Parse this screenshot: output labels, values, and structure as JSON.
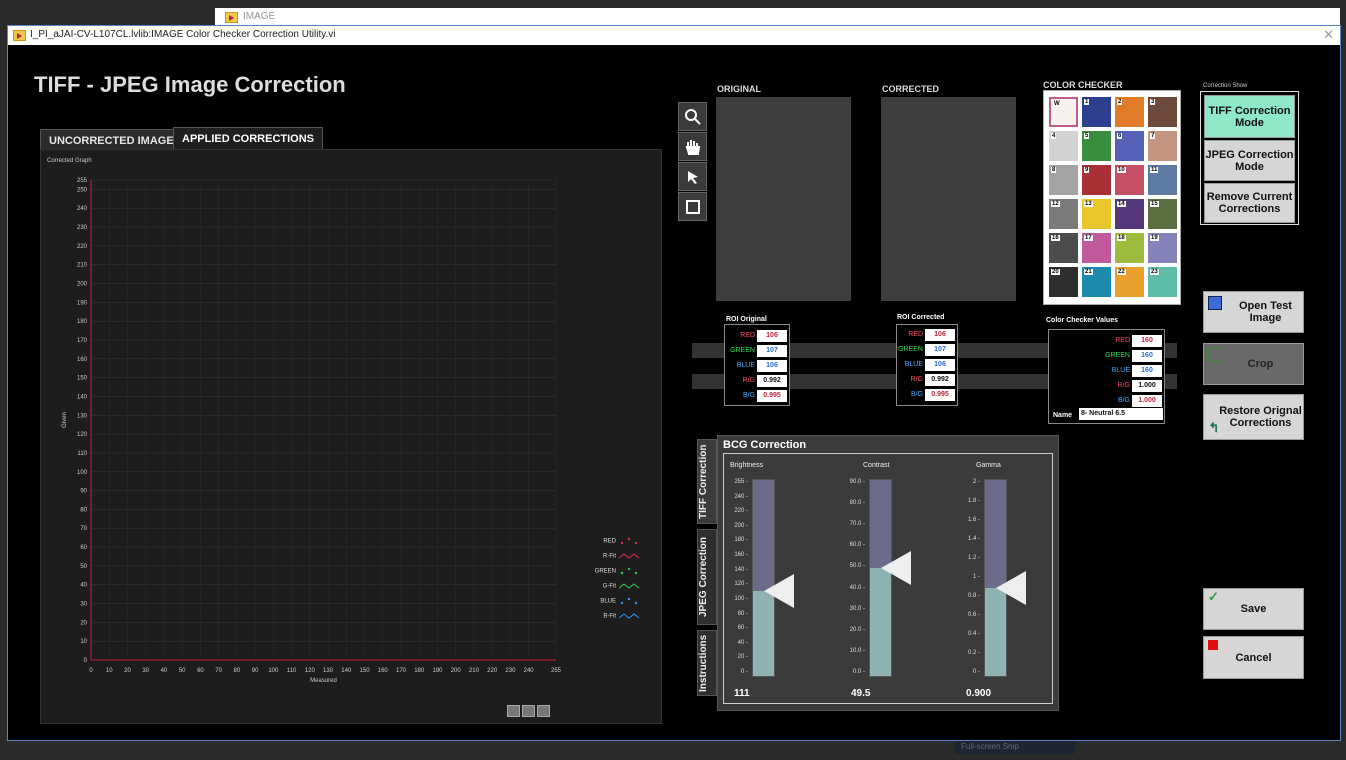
{
  "background": {
    "window_title": "IMAGE",
    "overlay_label": "Full-screen Snip"
  },
  "window": {
    "title": "I_PI_aJAI-CV-L107CL.lvlib:IMAGE Color Checker Correction Utility.vi",
    "close": "✕"
  },
  "app_title": "TIFF - JPEG Image Correction",
  "tabs": [
    "UNCORRECTED IMAGE",
    "APPLIED CORRECTIONS"
  ],
  "graph": {
    "title": "Corrected Graph",
    "xlabel": "Measured",
    "ylabel": "Given",
    "x_ticks": [
      "0",
      "10",
      "20",
      "30",
      "40",
      "50",
      "60",
      "70",
      "80",
      "90",
      "100",
      "110",
      "120",
      "130",
      "140",
      "150",
      "160",
      "170",
      "180",
      "190",
      "200",
      "210",
      "220",
      "230",
      "240",
      "255"
    ],
    "y_ticks": [
      "0",
      "10",
      "20",
      "30",
      "40",
      "50",
      "60",
      "70",
      "80",
      "90",
      "100",
      "110",
      "120",
      "130",
      "140",
      "150",
      "160",
      "170",
      "180",
      "190",
      "200",
      "210",
      "220",
      "230",
      "240",
      "250",
      "255"
    ],
    "legend": [
      {
        "label": "RED",
        "kind": "points",
        "color": "#e0304a"
      },
      {
        "label": "R-Fit",
        "kind": "line",
        "color": "#e0304a"
      },
      {
        "label": "GREEN",
        "kind": "points",
        "color": "#33cc55"
      },
      {
        "label": "G-Fit",
        "kind": "line",
        "color": "#33cc55"
      },
      {
        "label": "BLUE",
        "kind": "points",
        "color": "#3399ff"
      },
      {
        "label": "B-Fit",
        "kind": "line",
        "color": "#3399ff"
      }
    ]
  },
  "tools": [
    "zoom-icon",
    "pan-hand-icon",
    "pointer-arrow-icon",
    "roi-rectangle-icon"
  ],
  "panels": {
    "original": "ORIGINAL",
    "corrected": "CORRECTED",
    "color_checker": "COLOR CHECKER",
    "correction_show": "Correction Show"
  },
  "swatches": [
    {
      "label": "W",
      "color": "#f4f1ee"
    },
    {
      "label": "1",
      "color": "#2c3f8e"
    },
    {
      "label": "2",
      "color": "#e07b2a"
    },
    {
      "label": "3",
      "color": "#6e4a3c"
    },
    {
      "label": "4",
      "color": "#d3d3d3"
    },
    {
      "label": "5",
      "color": "#3a8d3f"
    },
    {
      "label": "6",
      "color": "#5560b7"
    },
    {
      "label": "7",
      "color": "#c49580"
    },
    {
      "label": "8",
      "color": "#a3a3a3"
    },
    {
      "label": "9",
      "color": "#a93037"
    },
    {
      "label": "10",
      "color": "#c44e63"
    },
    {
      "label": "11",
      "color": "#5e7aa3"
    },
    {
      "label": "12",
      "color": "#7a7a7a"
    },
    {
      "label": "13",
      "color": "#e8c62c"
    },
    {
      "label": "14",
      "color": "#54367a"
    },
    {
      "label": "15",
      "color": "#5c6d3f"
    },
    {
      "label": "16",
      "color": "#4c4c4c"
    },
    {
      "label": "17",
      "color": "#c05a9c"
    },
    {
      "label": "18",
      "color": "#9dbc3d"
    },
    {
      "label": "19",
      "color": "#8583ba"
    },
    {
      "label": "20",
      "color": "#2e2e2e"
    },
    {
      "label": "21",
      "color": "#1c8aac"
    },
    {
      "label": "22",
      "color": "#e9a02c"
    },
    {
      "label": "23",
      "color": "#5fbca8"
    }
  ],
  "roi_original": {
    "title": "ROI Original",
    "rows": [
      {
        "key": "RED",
        "value": "106",
        "kcolor": "#ff4a5e",
        "vcolor": "#c0243a"
      },
      {
        "key": "GREEN",
        "value": "107",
        "kcolor": "#33dd55",
        "vcolor": "#2a6bd0"
      },
      {
        "key": "BLUE",
        "value": "106",
        "kcolor": "#4aa8ff",
        "vcolor": "#2a6bd0"
      },
      {
        "key": "R/G",
        "value": "0.992",
        "kcolor": "#ff4a5e",
        "vcolor": "#111111"
      },
      {
        "key": "B/G",
        "value": "0.995",
        "kcolor": "#4aa8ff",
        "vcolor": "#c0243a"
      }
    ]
  },
  "roi_corrected": {
    "title": "ROI Corrected",
    "rows": [
      {
        "key": "RED",
        "value": "106",
        "kcolor": "#ff4a5e",
        "vcolor": "#c0243a"
      },
      {
        "key": "GREEN",
        "value": "107",
        "kcolor": "#33dd55",
        "vcolor": "#2a6bd0"
      },
      {
        "key": "BLUE",
        "value": "106",
        "kcolor": "#4aa8ff",
        "vcolor": "#2a6bd0"
      },
      {
        "key": "R/G",
        "value": "0.992",
        "kcolor": "#ff4a5e",
        "vcolor": "#111111"
      },
      {
        "key": "B/G",
        "value": "0.995",
        "kcolor": "#4aa8ff",
        "vcolor": "#c0243a"
      }
    ]
  },
  "checker_values": {
    "title": "Color Checker Values",
    "rows": [
      {
        "key": "RED",
        "value": "160",
        "kcolor": "#ff4a5e",
        "vcolor": "#c0243a"
      },
      {
        "key": "GREEN",
        "value": "160",
        "kcolor": "#33dd55",
        "vcolor": "#2a6bd0"
      },
      {
        "key": "BLUE",
        "value": "160",
        "kcolor": "#4aa8ff",
        "vcolor": "#2a6bd0"
      },
      {
        "key": "R/G",
        "value": "1.000",
        "kcolor": "#ff4a5e",
        "vcolor": "#111111"
      },
      {
        "key": "B/G",
        "value": "1.000",
        "kcolor": "#4aa8ff",
        "vcolor": "#c0243a"
      }
    ],
    "name_label": "Name",
    "name_value": "8- Neutral 6.5"
  },
  "mode_buttons": {
    "tiff": "TIFF Correction Mode",
    "jpeg": "JPEG Correction Mode",
    "remove": "Remove Current Corrections"
  },
  "actions": {
    "open": "Open Test Image",
    "crop": "Crop",
    "restore": "Restore Orignal Corrections",
    "save": "Save",
    "cancel": "Cancel"
  },
  "side_tabs": [
    "TIFF Correction",
    "JPEG Correction",
    "Instructions"
  ],
  "bcg": {
    "title": "BCG Correction",
    "sliders": [
      {
        "label": "Brightness",
        "value": "111",
        "level": 0.435,
        "ticks": [
          "255",
          "240",
          "220",
          "200",
          "180",
          "160",
          "140",
          "120",
          "100",
          "80",
          "60",
          "40",
          "20",
          "0"
        ]
      },
      {
        "label": "Contrast",
        "value": "49.5",
        "level": 0.55,
        "ticks": [
          "90.0",
          "80.0",
          "70.0",
          "60.0",
          "50.0",
          "40.0",
          "30.0",
          "20.0",
          "10.0",
          "0.0"
        ]
      },
      {
        "label": "Gamma",
        "value": "0.900",
        "level": 0.45,
        "ticks": [
          "2",
          "1.8",
          "1.6",
          "1.4",
          "1.2",
          "1",
          "0.8",
          "0.6",
          "0.4",
          "0.2",
          "0"
        ]
      }
    ]
  }
}
